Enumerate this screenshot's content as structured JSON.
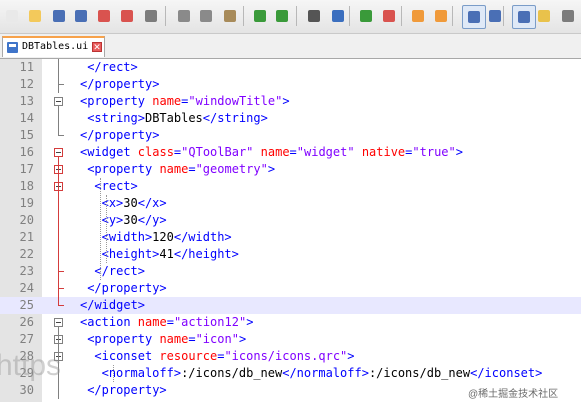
{
  "tab": {
    "label": "DBTables.ui",
    "close_glyph": "✕"
  },
  "toolbar": {
    "buttons": [
      {
        "name": "new-file-button",
        "color": "#e9e9e9"
      },
      {
        "name": "open-file-button",
        "color": "#f3c95b"
      },
      {
        "name": "save-button",
        "color": "#4a6fb5"
      },
      {
        "name": "save-all-button",
        "color": "#4a6fb5"
      },
      {
        "name": "close-button",
        "color": "#d9534f"
      },
      {
        "name": "close-all-button",
        "color": "#d9534f"
      },
      {
        "name": "print-button",
        "color": "#7c7c7c"
      },
      {
        "name": "cut-button",
        "color": "#8a8a8a"
      },
      {
        "name": "copy-button",
        "color": "#8a8a8a"
      },
      {
        "name": "paste-button",
        "color": "#a88b5a"
      },
      {
        "name": "undo-button",
        "color": "#3a9a3a"
      },
      {
        "name": "redo-button",
        "color": "#3a9a3a"
      },
      {
        "name": "find-button",
        "color": "#555555"
      },
      {
        "name": "replace-button",
        "color": "#3b6fbf"
      },
      {
        "name": "zoom-in-button",
        "color": "#3a9a3a"
      },
      {
        "name": "zoom-out-button",
        "color": "#d9534f"
      },
      {
        "name": "sync-v-button",
        "color": "#f09a3a"
      },
      {
        "name": "sync-h-button",
        "color": "#f09a3a"
      },
      {
        "name": "word-wrap-button",
        "color": "#4a6fb5"
      },
      {
        "name": "show-all-chars-button",
        "color": "#4a6fb5"
      },
      {
        "name": "indent-guide-button",
        "color": "#4a6fb5"
      },
      {
        "name": "doc-map-button",
        "color": "#e9c24b"
      },
      {
        "name": "function-list-button",
        "color": "#7c7c7c"
      }
    ]
  },
  "lines": [
    {
      "num": "11",
      "indent": 2,
      "tokens": [
        {
          "c": "tag",
          "t": "</rect>"
        }
      ]
    },
    {
      "num": "12",
      "indent": 1,
      "tokens": [
        {
          "c": "tag",
          "t": "</property>"
        }
      ]
    },
    {
      "num": "13",
      "indent": 1,
      "tokens": [
        {
          "c": "tag",
          "t": "<property "
        },
        {
          "c": "attr",
          "t": "name"
        },
        {
          "c": "tag",
          "t": "="
        },
        {
          "c": "val",
          "t": "\"windowTitle\""
        },
        {
          "c": "tag",
          "t": ">"
        }
      ]
    },
    {
      "num": "14",
      "indent": 2,
      "tokens": [
        {
          "c": "tag",
          "t": "<string>"
        },
        {
          "c": "txt",
          "t": "DBTables"
        },
        {
          "c": "tag",
          "t": "</string>"
        }
      ]
    },
    {
      "num": "15",
      "indent": 1,
      "tokens": [
        {
          "c": "tag",
          "t": "</property>"
        }
      ]
    },
    {
      "num": "16",
      "indent": 1,
      "tokens": [
        {
          "c": "tag",
          "t": "<widget "
        },
        {
          "c": "attr",
          "t": "class"
        },
        {
          "c": "tag",
          "t": "="
        },
        {
          "c": "val",
          "t": "\"QToolBar\""
        },
        {
          "c": "tag",
          "t": " "
        },
        {
          "c": "attr",
          "t": "name"
        },
        {
          "c": "tag",
          "t": "="
        },
        {
          "c": "val",
          "t": "\"widget\""
        },
        {
          "c": "tag",
          "t": " "
        },
        {
          "c": "attr",
          "t": "native"
        },
        {
          "c": "tag",
          "t": "="
        },
        {
          "c": "val",
          "t": "\"true\""
        },
        {
          "c": "tag",
          "t": ">"
        }
      ]
    },
    {
      "num": "17",
      "indent": 2,
      "tokens": [
        {
          "c": "tag",
          "t": "<property "
        },
        {
          "c": "attr",
          "t": "name"
        },
        {
          "c": "tag",
          "t": "="
        },
        {
          "c": "val",
          "t": "\"geometry\""
        },
        {
          "c": "tag",
          "t": ">"
        }
      ]
    },
    {
      "num": "18",
      "indent": 3,
      "tokens": [
        {
          "c": "tag",
          "t": "<rect>"
        }
      ]
    },
    {
      "num": "19",
      "indent": 4,
      "tokens": [
        {
          "c": "tag",
          "t": "<x>"
        },
        {
          "c": "txt",
          "t": "30"
        },
        {
          "c": "tag",
          "t": "</x>"
        }
      ]
    },
    {
      "num": "20",
      "indent": 4,
      "tokens": [
        {
          "c": "tag",
          "t": "<y>"
        },
        {
          "c": "txt",
          "t": "30"
        },
        {
          "c": "tag",
          "t": "</y>"
        }
      ]
    },
    {
      "num": "21",
      "indent": 4,
      "tokens": [
        {
          "c": "tag",
          "t": "<width>"
        },
        {
          "c": "txt",
          "t": "120"
        },
        {
          "c": "tag",
          "t": "</width>"
        }
      ]
    },
    {
      "num": "22",
      "indent": 4,
      "tokens": [
        {
          "c": "tag",
          "t": "<height>"
        },
        {
          "c": "txt",
          "t": "41"
        },
        {
          "c": "tag",
          "t": "</height>"
        }
      ]
    },
    {
      "num": "23",
      "indent": 3,
      "tokens": [
        {
          "c": "tag",
          "t": "</rect>"
        }
      ]
    },
    {
      "num": "24",
      "indent": 2,
      "tokens": [
        {
          "c": "tag",
          "t": "</property>"
        }
      ]
    },
    {
      "num": "25",
      "indent": 1,
      "highlight": true,
      "tokens": [
        {
          "c": "tag",
          "t": "</widget>"
        }
      ]
    },
    {
      "num": "26",
      "indent": 1,
      "tokens": [
        {
          "c": "tag",
          "t": "<action "
        },
        {
          "c": "attr",
          "t": "name"
        },
        {
          "c": "tag",
          "t": "="
        },
        {
          "c": "val",
          "t": "\"action12\""
        },
        {
          "c": "tag",
          "t": ">"
        }
      ]
    },
    {
      "num": "27",
      "indent": 2,
      "tokens": [
        {
          "c": "tag",
          "t": "<property "
        },
        {
          "c": "attr",
          "t": "name"
        },
        {
          "c": "tag",
          "t": "="
        },
        {
          "c": "val",
          "t": "\"icon\""
        },
        {
          "c": "tag",
          "t": ">"
        }
      ]
    },
    {
      "num": "28",
      "indent": 3,
      "tokens": [
        {
          "c": "tag",
          "t": "<iconset "
        },
        {
          "c": "attr",
          "t": "resource"
        },
        {
          "c": "tag",
          "t": "="
        },
        {
          "c": "val",
          "t": "\"icons/icons.qrc\""
        },
        {
          "c": "tag",
          "t": ">"
        }
      ]
    },
    {
      "num": "29",
      "indent": 4,
      "tokens": [
        {
          "c": "tag",
          "t": "<normaloff>"
        },
        {
          "c": "txt",
          "t": ":/icons/db_new"
        },
        {
          "c": "tag",
          "t": "</normaloff>"
        },
        {
          "c": "txt",
          "t": ":/icons/db_new"
        },
        {
          "c": "tag",
          "t": "</iconset>"
        }
      ]
    },
    {
      "num": "30",
      "indent": 2,
      "tokens": [
        {
          "c": "tag",
          "t": "</property>"
        }
      ]
    }
  ],
  "watermark": {
    "left_text": "https",
    "right_text": "@稀土掘金技术社区"
  }
}
